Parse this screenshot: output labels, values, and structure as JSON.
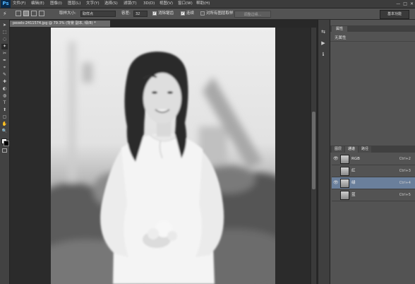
{
  "app": {
    "logo": "Ps"
  },
  "menu": [
    "文件(F)",
    "编辑(E)",
    "图像(I)",
    "图层(L)",
    "文字(Y)",
    "选择(S)",
    "滤镜(T)",
    "3D(D)",
    "视图(V)",
    "窗口(W)",
    "帮助(H)"
  ],
  "window_controls": [
    "—",
    "□",
    "✕"
  ],
  "options": {
    "brush_size_label": "取样大小:",
    "brush_size_value": "取样点",
    "tolerance_label": "容差:",
    "tolerance_value": "32",
    "antialias_label": "消除锯齿",
    "contiguous_label": "连续",
    "sample_all_label": "对所有图层取样",
    "refine_edge_label": "调整边缘...",
    "workspace_label": "基本功能"
  },
  "document": {
    "tab_title": "pexels-2411574.jpg @ 79.3% (背景 副本, 绿/8) *"
  },
  "tools": [
    "➤",
    "⬚",
    "◌",
    "✦",
    "✂",
    "✒",
    "⌖",
    "✎",
    "✚",
    "◐",
    "◍",
    "T",
    "⬆",
    "▢",
    "✋",
    "🔍"
  ],
  "dock_icons": [
    "⇆",
    "▶",
    "ℹ"
  ],
  "properties": {
    "tab_label": "属性",
    "subtitle": "无属性"
  },
  "channels": {
    "tabs": [
      "图层",
      "通道",
      "路径"
    ],
    "rows": [
      {
        "name": "RGB",
        "shortcut": "Ctrl+2",
        "visible": true,
        "selected": false
      },
      {
        "name": "红",
        "shortcut": "Ctrl+3",
        "visible": false,
        "selected": false
      },
      {
        "name": "绿",
        "shortcut": "Ctrl+4",
        "visible": true,
        "selected": true
      },
      {
        "name": "蓝",
        "shortcut": "Ctrl+5",
        "visible": false,
        "selected": false
      }
    ]
  },
  "colors": {
    "selected_row": "#6a7f9b",
    "panel": "#535353",
    "menubar": "#3c3c3c"
  }
}
